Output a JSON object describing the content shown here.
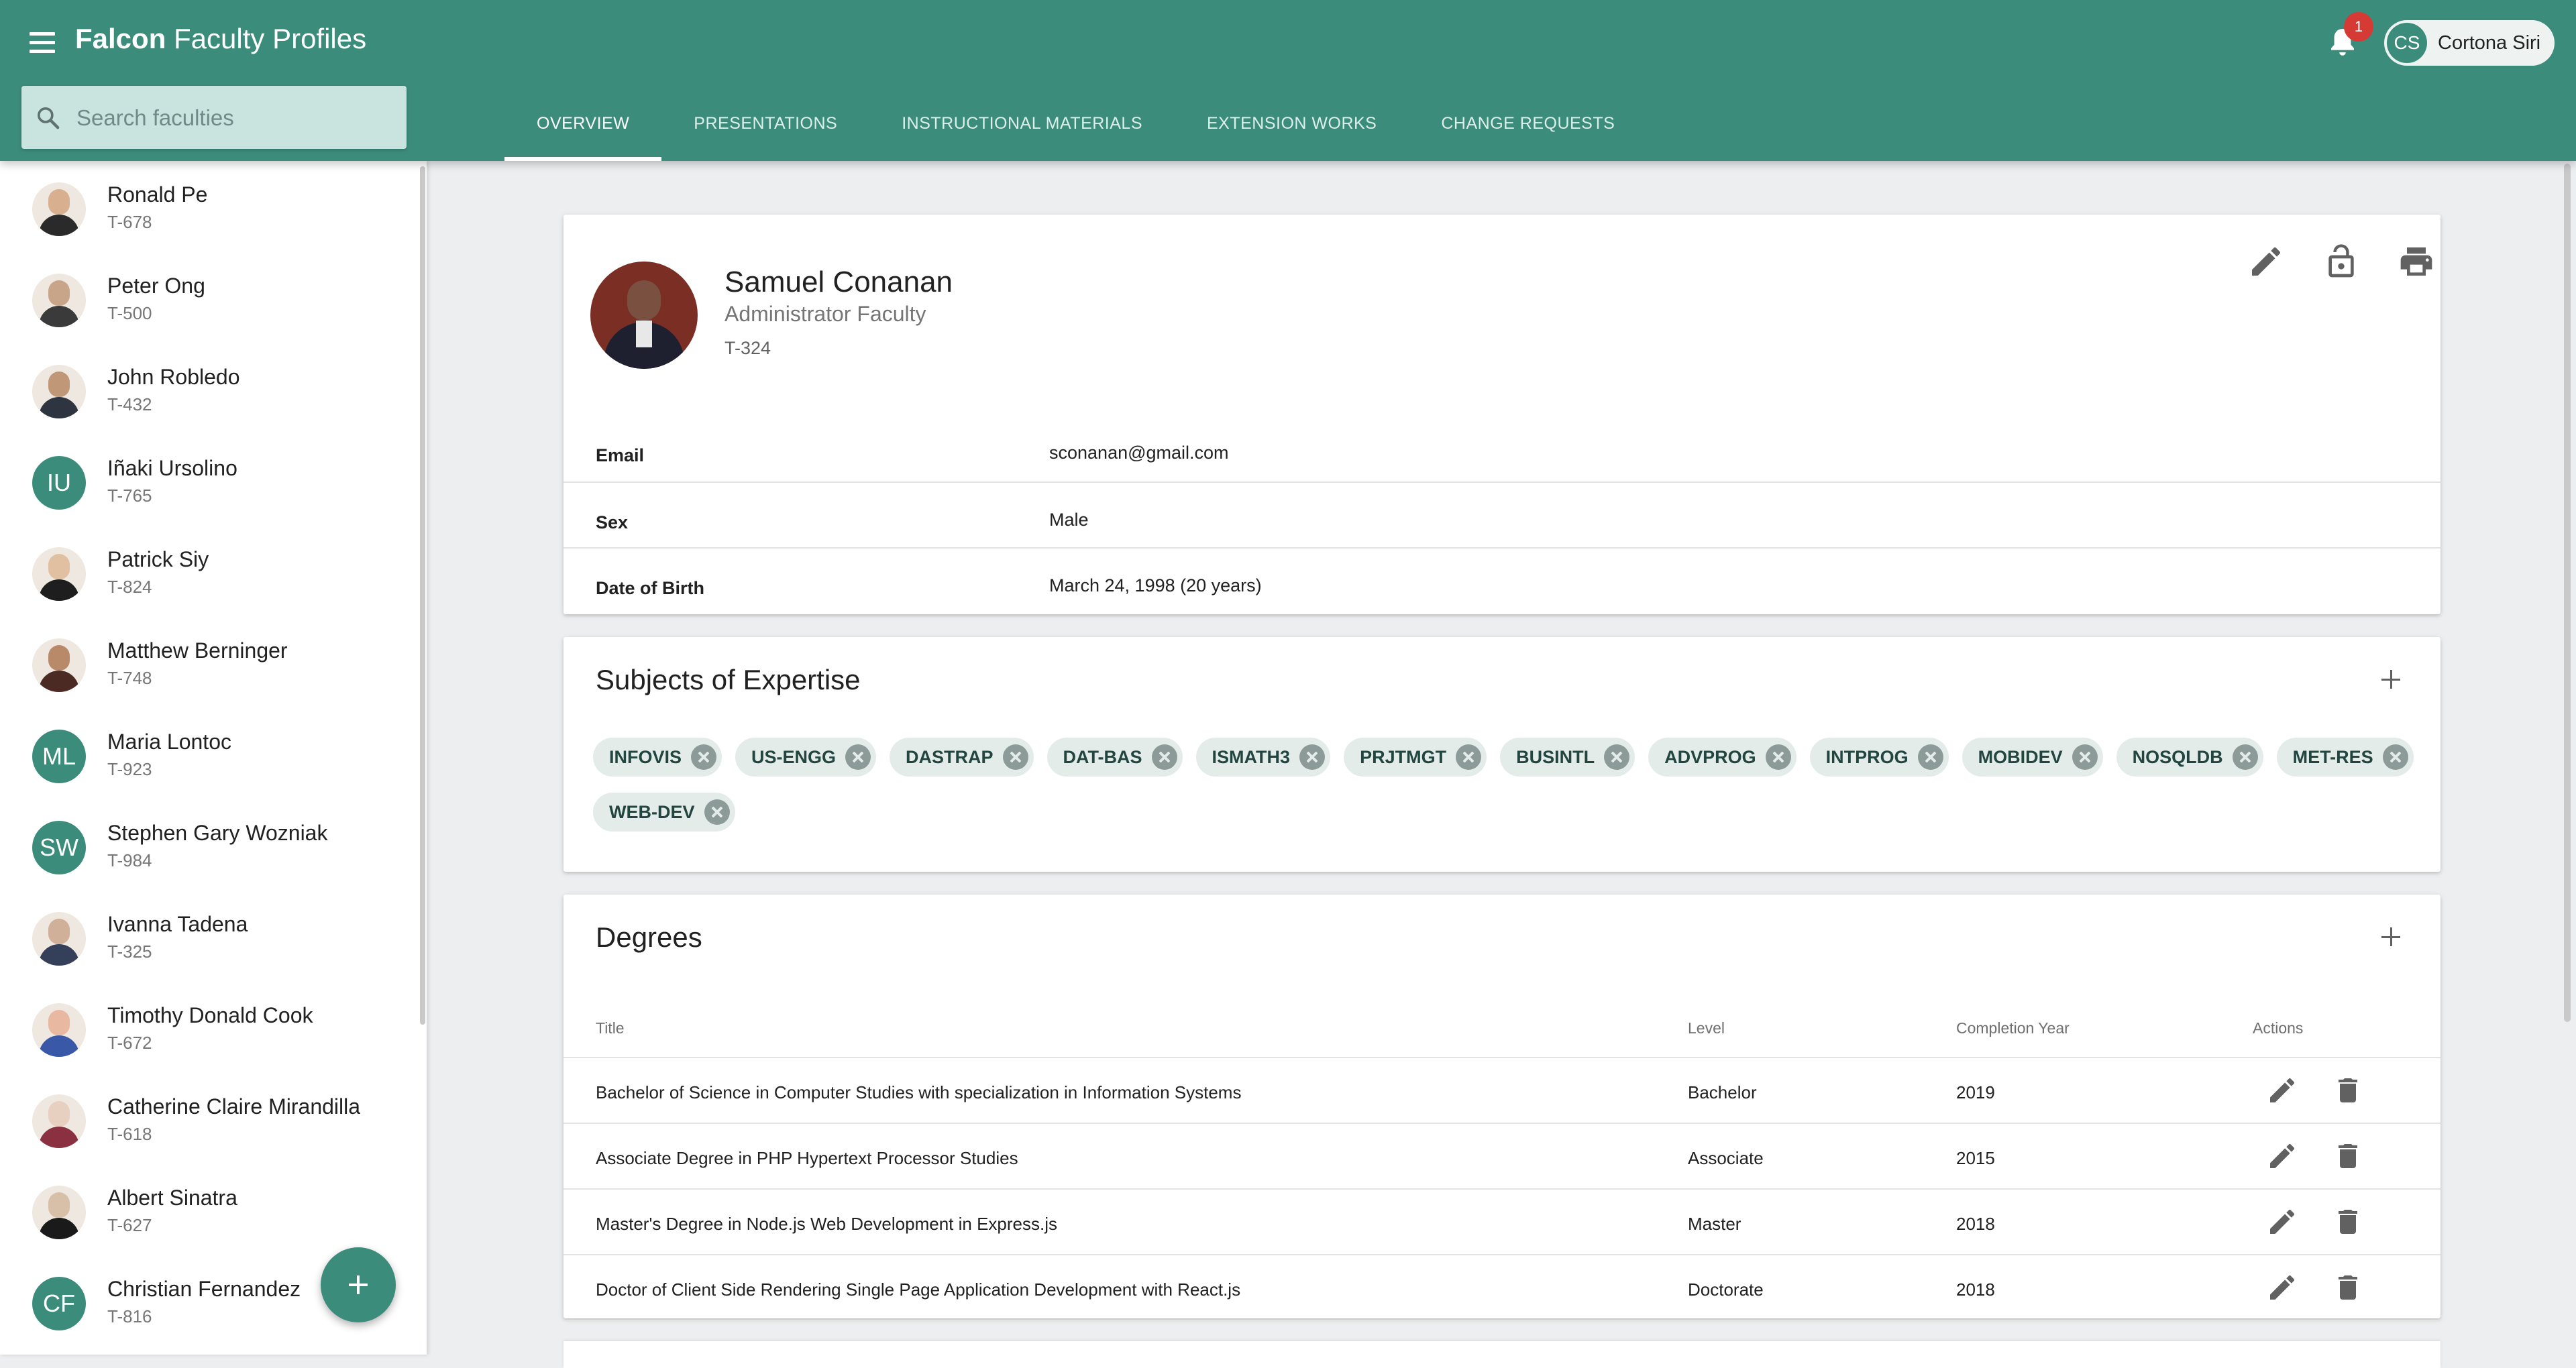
{
  "app": {
    "brand": "Falcon",
    "title_rest": " Faculty Profiles",
    "notification_count": "1",
    "user": {
      "initials": "CS",
      "name": "Cortona Siri"
    }
  },
  "search": {
    "placeholder": "Search faculties",
    "value": ""
  },
  "tabs": [
    {
      "label": "OVERVIEW",
      "active": true
    },
    {
      "label": "PRESENTATIONS",
      "active": false
    },
    {
      "label": "INSTRUCTIONAL MATERIALS",
      "active": false
    },
    {
      "label": "EXTENSION WORKS",
      "active": false
    },
    {
      "label": "CHANGE REQUESTS",
      "active": false
    }
  ],
  "faculties": [
    {
      "name": "Ronald Pe",
      "code": "T-678",
      "avatar": "photo",
      "skin": "#d8b090",
      "clothes": "#2a2a2a"
    },
    {
      "name": "Peter Ong",
      "code": "T-500",
      "avatar": "photo",
      "skin": "#c8a588",
      "clothes": "#3a3a3a"
    },
    {
      "name": "John Robledo",
      "code": "T-432",
      "avatar": "photo",
      "skin": "#c09878",
      "clothes": "#2e3440"
    },
    {
      "name": "Iñaki Ursolino",
      "code": "T-765",
      "avatar": "initials",
      "initials": "IU"
    },
    {
      "name": "Patrick Siy",
      "code": "T-824",
      "avatar": "photo",
      "skin": "#e0c0a0",
      "clothes": "#1e1e1e"
    },
    {
      "name": "Matthew Berninger",
      "code": "T-748",
      "avatar": "photo",
      "skin": "#b88a6a",
      "clothes": "#4a2a22"
    },
    {
      "name": "Maria Lontoc",
      "code": "T-923",
      "avatar": "initials",
      "initials": "ML"
    },
    {
      "name": "Stephen Gary Wozniak",
      "code": "T-984",
      "avatar": "initials",
      "initials": "SW"
    },
    {
      "name": "Ivanna Tadena",
      "code": "T-325",
      "avatar": "photo",
      "skin": "#d0b098",
      "clothes": "#34405a"
    },
    {
      "name": "Timothy Donald Cook",
      "code": "T-672",
      "avatar": "photo",
      "skin": "#e8b8a0",
      "clothes": "#3a58a8"
    },
    {
      "name": "Catherine Claire Mirandilla",
      "code": "T-618",
      "avatar": "photo",
      "skin": "#e8d0c0",
      "clothes": "#8a3040"
    },
    {
      "name": "Albert Sinatra",
      "code": "T-627",
      "avatar": "photo",
      "skin": "#d8c0a8",
      "clothes": "#1a1a1a"
    },
    {
      "name": "Christian Fernandez",
      "code": "T-816",
      "avatar": "initials",
      "initials": "CF"
    }
  ],
  "profile": {
    "name": "Samuel Conanan",
    "role": "Administrator Faculty",
    "code": "T-324",
    "fields": [
      {
        "label": "Email",
        "value": "sconanan@gmail.com"
      },
      {
        "label": "Sex",
        "value": "Male"
      },
      {
        "label": "Date of Birth",
        "value": "March 24, 1998 (20 years)"
      }
    ]
  },
  "expertise": {
    "title": "Subjects of Expertise",
    "subjects": [
      "INFOVIS",
      "US-ENGG",
      "DASTRAP",
      "DAT-BAS",
      "ISMATH3",
      "PRJTMGT",
      "BUSINTL",
      "ADVPROG",
      "INTPROG",
      "MOBIDEV",
      "NOSQLDB",
      "MET-RES",
      "WEB-DEV"
    ]
  },
  "degrees": {
    "title": "Degrees",
    "columns": {
      "title": "Title",
      "level": "Level",
      "year": "Completion Year",
      "actions": "Actions"
    },
    "rows": [
      {
        "title": "Bachelor of Science in Computer Studies with specialization in Information Systems",
        "level": "Bachelor",
        "year": "2019"
      },
      {
        "title": "Associate Degree in PHP Hypertext Processor Studies",
        "level": "Associate",
        "year": "2015"
      },
      {
        "title": "Master's Degree in Node.js Web Development in Express.js",
        "level": "Master",
        "year": "2018"
      },
      {
        "title": "Doctor of Client Side Rendering Single Page Application Development with React.js",
        "level": "Doctorate",
        "year": "2018"
      }
    ]
  },
  "colors": {
    "primary": "#3c8c7c",
    "badge": "#d53a35",
    "search_bg": "#c9e3df",
    "chip_bg": "#e4ece9",
    "page_bg": "#eceeef"
  },
  "icons": {
    "menu": "menu-icon",
    "search": "search-icon",
    "bell": "bell-icon",
    "edit": "pencil-icon",
    "lock": "lock-open-icon",
    "print": "printer-icon",
    "add": "plus-icon",
    "remove": "close-circle-icon",
    "delete": "trash-icon"
  }
}
